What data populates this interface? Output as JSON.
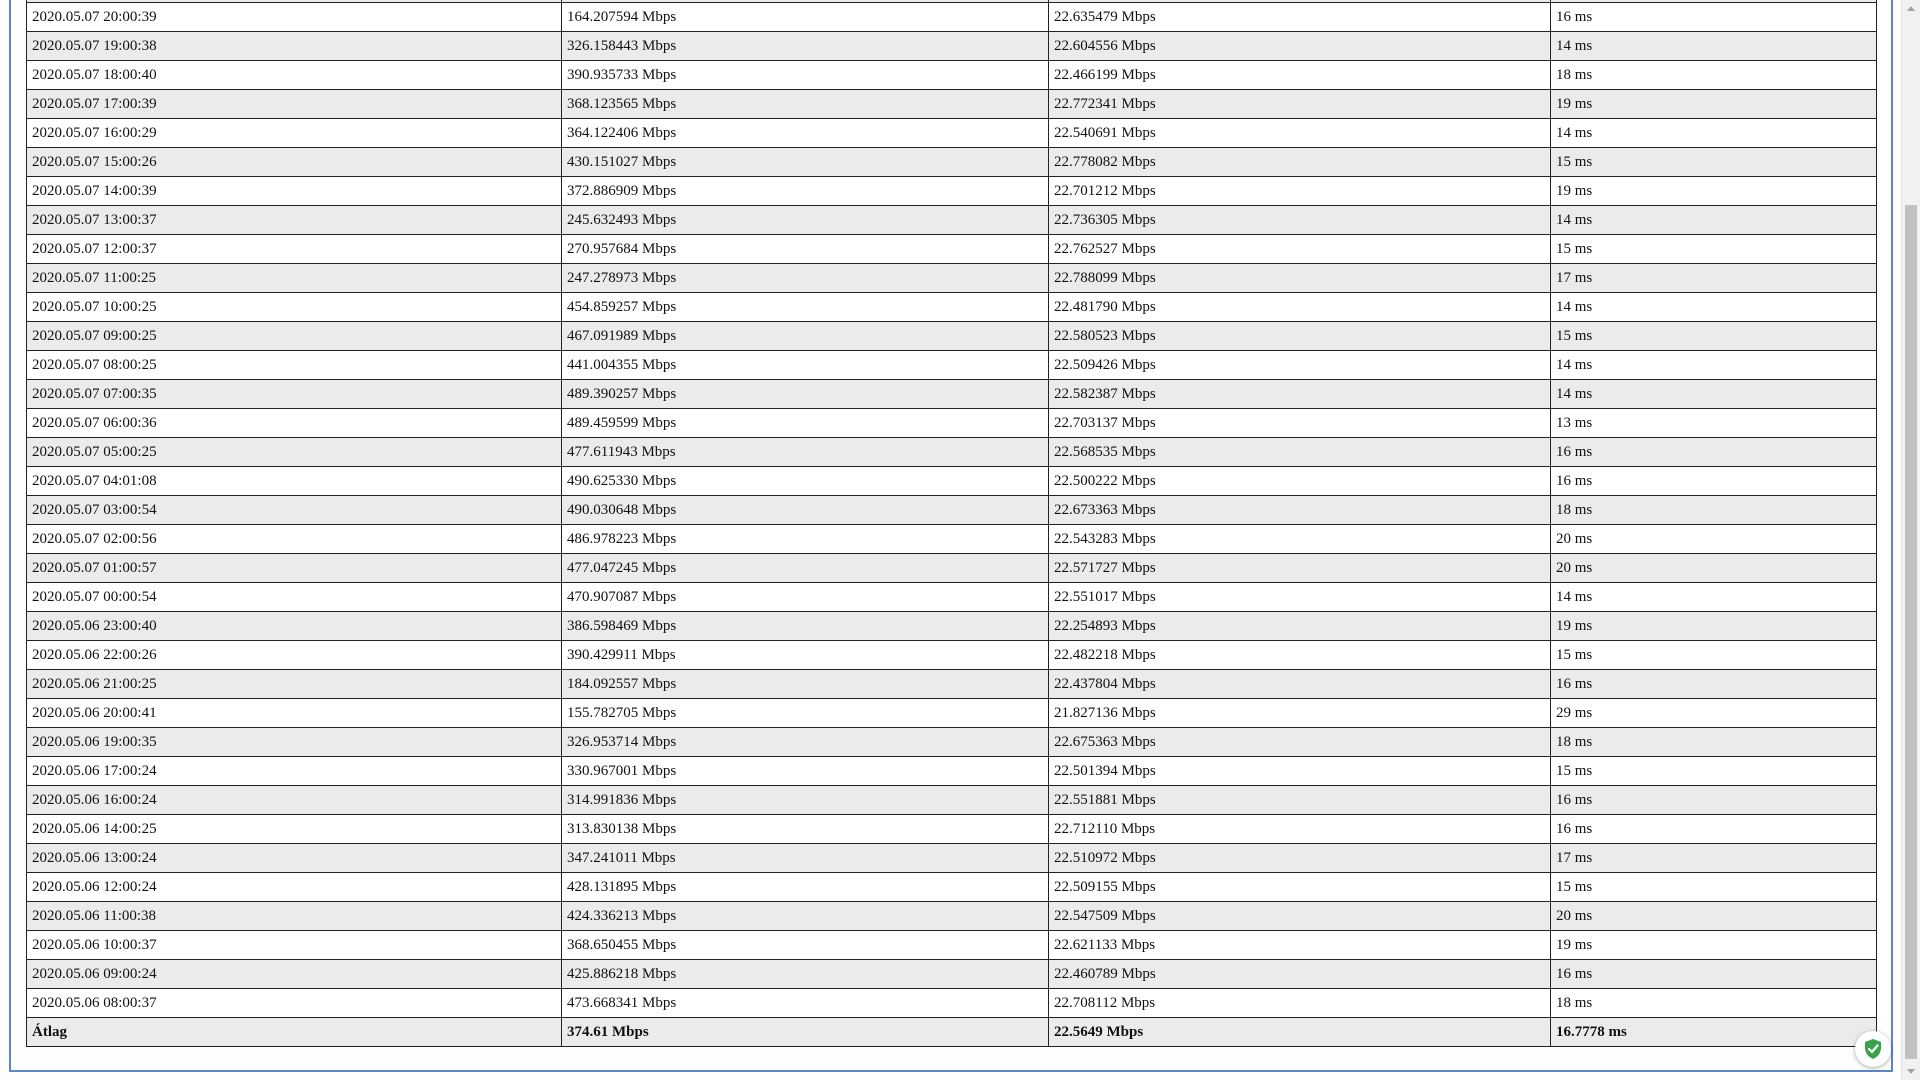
{
  "table": {
    "rows": [
      [
        "2020.05.07 20:00:39",
        "164.207594 Mbps",
        "22.635479 Mbps",
        "16 ms"
      ],
      [
        "2020.05.07 19:00:38",
        "326.158443 Mbps",
        "22.604556 Mbps",
        "14 ms"
      ],
      [
        "2020.05.07 18:00:40",
        "390.935733 Mbps",
        "22.466199 Mbps",
        "18 ms"
      ],
      [
        "2020.05.07 17:00:39",
        "368.123565 Mbps",
        "22.772341 Mbps",
        "19 ms"
      ],
      [
        "2020.05.07 16:00:29",
        "364.122406 Mbps",
        "22.540691 Mbps",
        "14 ms"
      ],
      [
        "2020.05.07 15:00:26",
        "430.151027 Mbps",
        "22.778082 Mbps",
        "15 ms"
      ],
      [
        "2020.05.07 14:00:39",
        "372.886909 Mbps",
        "22.701212 Mbps",
        "19 ms"
      ],
      [
        "2020.05.07 13:00:37",
        "245.632493 Mbps",
        "22.736305 Mbps",
        "14 ms"
      ],
      [
        "2020.05.07 12:00:37",
        "270.957684 Mbps",
        "22.762527 Mbps",
        "15 ms"
      ],
      [
        "2020.05.07 11:00:25",
        "247.278973 Mbps",
        "22.788099 Mbps",
        "17 ms"
      ],
      [
        "2020.05.07 10:00:25",
        "454.859257 Mbps",
        "22.481790 Mbps",
        "14 ms"
      ],
      [
        "2020.05.07 09:00:25",
        "467.091989 Mbps",
        "22.580523 Mbps",
        "15 ms"
      ],
      [
        "2020.05.07 08:00:25",
        "441.004355 Mbps",
        "22.509426 Mbps",
        "14 ms"
      ],
      [
        "2020.05.07 07:00:35",
        "489.390257 Mbps",
        "22.582387 Mbps",
        "14 ms"
      ],
      [
        "2020.05.07 06:00:36",
        "489.459599 Mbps",
        "22.703137 Mbps",
        "13 ms"
      ],
      [
        "2020.05.07 05:00:25",
        "477.611943 Mbps",
        "22.568535 Mbps",
        "16 ms"
      ],
      [
        "2020.05.07 04:01:08",
        "490.625330 Mbps",
        "22.500222 Mbps",
        "16 ms"
      ],
      [
        "2020.05.07 03:00:54",
        "490.030648 Mbps",
        "22.673363 Mbps",
        "18 ms"
      ],
      [
        "2020.05.07 02:00:56",
        "486.978223 Mbps",
        "22.543283 Mbps",
        "20 ms"
      ],
      [
        "2020.05.07 01:00:57",
        "477.047245 Mbps",
        "22.571727 Mbps",
        "20 ms"
      ],
      [
        "2020.05.07 00:00:54",
        "470.907087 Mbps",
        "22.551017 Mbps",
        "14 ms"
      ],
      [
        "2020.05.06 23:00:40",
        "386.598469 Mbps",
        "22.254893 Mbps",
        "19 ms"
      ],
      [
        "2020.05.06 22:00:26",
        "390.429911 Mbps",
        "22.482218 Mbps",
        "15 ms"
      ],
      [
        "2020.05.06 21:00:25",
        "184.092557 Mbps",
        "22.437804 Mbps",
        "16 ms"
      ],
      [
        "2020.05.06 20:00:41",
        "155.782705 Mbps",
        "21.827136 Mbps",
        "29 ms"
      ],
      [
        "2020.05.06 19:00:35",
        "326.953714 Mbps",
        "22.675363 Mbps",
        "18 ms"
      ],
      [
        "2020.05.06 17:00:24",
        "330.967001 Mbps",
        "22.501394 Mbps",
        "15 ms"
      ],
      [
        "2020.05.06 16:00:24",
        "314.991836 Mbps",
        "22.551881 Mbps",
        "16 ms"
      ],
      [
        "2020.05.06 14:00:25",
        "313.830138 Mbps",
        "22.712110 Mbps",
        "16 ms"
      ],
      [
        "2020.05.06 13:00:24",
        "347.241011 Mbps",
        "22.510972 Mbps",
        "17 ms"
      ],
      [
        "2020.05.06 12:00:24",
        "428.131895 Mbps",
        "22.509155 Mbps",
        "15 ms"
      ],
      [
        "2020.05.06 11:00:38",
        "424.336213 Mbps",
        "22.547509 Mbps",
        "20 ms"
      ],
      [
        "2020.05.06 10:00:37",
        "368.650455 Mbps",
        "22.621133 Mbps",
        "19 ms"
      ],
      [
        "2020.05.06 09:00:24",
        "425.886218 Mbps",
        "22.460789 Mbps",
        "16 ms"
      ],
      [
        "2020.05.06 08:00:37",
        "473.668341 Mbps",
        "22.708112 Mbps",
        "18 ms"
      ]
    ],
    "average": [
      "Átlag",
      "374.61 Mbps",
      "22.5649 Mbps",
      "16.7778 ms"
    ]
  },
  "icons": {
    "badge": "shield-check-icon",
    "scroll_up": "scroll-up-arrow-icon",
    "scroll_down": "scroll-down-arrow-icon"
  },
  "colors": {
    "frame_border": "#5b86c7",
    "row_alt": "#ebebeb",
    "badge_check": "#3aa34a"
  }
}
